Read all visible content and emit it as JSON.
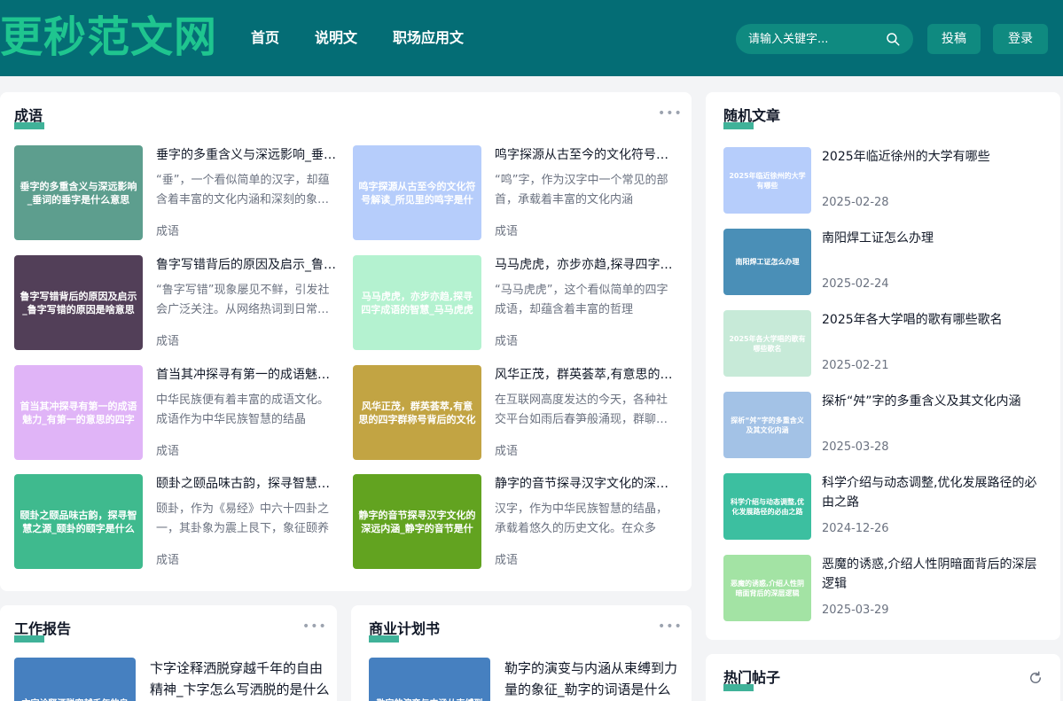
{
  "header": {
    "logo": "更秒范文网",
    "nav": [
      "首页",
      "说明文",
      "职场应用文"
    ],
    "search_placeholder": "请输入关键字...",
    "submit_label": "投稿",
    "login_label": "登录"
  },
  "colors": {
    "header_bg": "#046d75",
    "accent_green": "#1fc58f",
    "button_teal": "#0f8a80"
  },
  "idioms": {
    "title": "成语",
    "items": [
      {
        "thumb_text": "垂字的多重含义与深远影响_垂词的垂字是什么意思",
        "thumb_color": "#5d9e8e",
        "title": "垂字的多重含义与深远影响_垂词的垂字是什么意思",
        "desc": "“垂”，一个看似简单的汉字，却蕴含着丰富的文化内涵和深刻的象征意义",
        "category": "成语"
      },
      {
        "thumb_text": "鸣字探源从古至今的文化符号解读_所见里的鸣字是什",
        "thumb_color": "#b6cdfb",
        "title": "鸣字探源从古至今的文化符号解读_所见里的鸣字是什",
        "desc": "“鸣”字，作为汉字中一个常见的部首，承载着丰富的文化内涵",
        "category": "成语"
      },
      {
        "thumb_text": "鲁字写错背后的原因及启示_鲁字写错的原因是啥意思",
        "thumb_color": "#523f58",
        "title": "鲁字写错背后的原因及启示_鲁字写错的原因是啥意思",
        "desc": "“鲁字写错”现象屡见不鲜，引发社会广泛关注。从网络热词到日常书写",
        "category": "成语"
      },
      {
        "thumb_text": "马马虎虎，亦步亦趋,探寻四字成语的智慧_马马虎虎",
        "thumb_color": "#b4f2d0",
        "title": "马马虎虎，亦步亦趋,探寻四字成语的智慧_马马虎虎",
        "desc": "“马马虎虎”，这个看似简单的四字成语，却蕴含着丰富的哲理",
        "category": "成语"
      },
      {
        "thumb_text": "首当其冲探寻有第一的成语魅力_有第一的意思的四字",
        "thumb_color": "#e0b4f7",
        "title": "首当其冲探寻有第一的成语魅力_有第一的意思的四字",
        "desc": "中华民族便有着丰富的成语文化。成语作为中华民族智慧的结晶",
        "category": "成语"
      },
      {
        "thumb_text": "风华正茂，群英荟萃,有意思的四字群称号背后的文化",
        "thumb_color": "#c2a443",
        "title": "风华正茂，群英荟萃,有意思的四字群称号背后的文化",
        "desc": "在互联网高度发达的今天，各种社交平台如雨后春笋般涌现，群聊成为",
        "category": "成语"
      },
      {
        "thumb_text": "颐卦之颐品味古韵，探寻智慧之源_颐卦的颐字是什么",
        "thumb_color": "#3fba8e",
        "title": "颐卦之颐品味古韵，探寻智慧之源_颐卦的颐字是什么",
        "desc": "颐卦，作为《易经》中六十四卦之一，其卦象为震上艮下，象征颐养",
        "category": "成语"
      },
      {
        "thumb_text": "静字的音节探寻汉字文化的深远内涵_静字的音节是什",
        "thumb_color": "#62a320",
        "title": "静字的音节探寻汉字文化的深远内涵_静字的音节是什",
        "desc": "汉字，作为中华民族智慧的结晶，承载着悠久的历史文化。在众多",
        "category": "成语"
      }
    ]
  },
  "random": {
    "title": "随机文章",
    "items": [
      {
        "thumb_text": "2025年临近徐州的大学有哪些",
        "thumb_color": "#b6cdfb",
        "title": "2025年临近徐州的大学有哪些",
        "date": "2025-02-28"
      },
      {
        "thumb_text": "南阳焊工证怎么办理",
        "thumb_color": "#4a8fb7",
        "title": "南阳焊工证怎么办理",
        "date": "2025-02-24"
      },
      {
        "thumb_text": "2025年各大学唱的歌有哪些歌名",
        "thumb_color": "#c7ead8",
        "title": "2025年各大学唱的歌有哪些歌名",
        "date": "2025-02-21"
      },
      {
        "thumb_text": "探析“舛”字的多重含义及其文化内涵",
        "thumb_color": "#a3c2e6",
        "title": "探析“舛”字的多重含义及其文化内涵",
        "date": "2025-03-28"
      },
      {
        "thumb_text": "科学介绍与动态调整,优化发展路径的必由之路",
        "thumb_color": "#3cbfa0",
        "title": "科学介绍与动态调整,优化发展路径的必由之路",
        "date": "2024-12-26"
      },
      {
        "thumb_text": "恶魔的诱惑,介绍人性阴暗面背后的深层逻辑",
        "thumb_color": "#a3e3a4",
        "title": "恶魔的诱惑,介绍人性阴暗面背后的深层逻辑",
        "date": "2025-03-29"
      }
    ]
  },
  "work_report": {
    "title": "工作报告",
    "item": {
      "thumb_text": "卞字诠释洒脱穿越千年的自",
      "title": "卞字诠释洒脱穿越千年的自由精神_卞字怎么写洒脱的是什么"
    }
  },
  "business_plan": {
    "title": "商业计划书",
    "item": {
      "thumb_text": "勒字的演变与内涵从束缚到",
      "title": "勒字的演变与内涵从束缚到力量的象征_勒字的词语是什么"
    }
  },
  "hot_posts": {
    "title": "热门帖子"
  }
}
